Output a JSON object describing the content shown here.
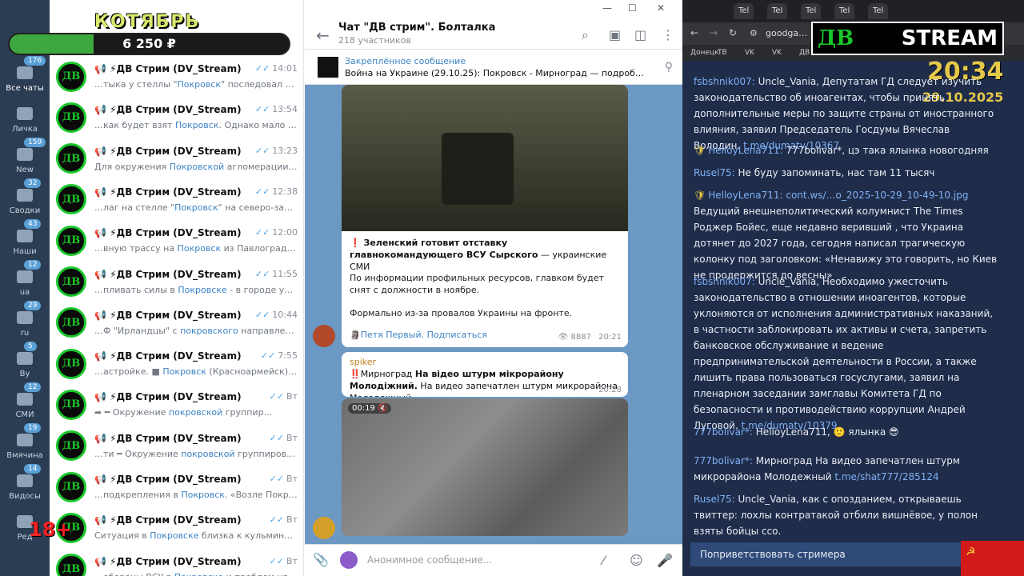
{
  "rail": {
    "items": [
      {
        "label": "Все чаты",
        "badge": "176"
      },
      {
        "label": "Личка",
        "badge": ""
      },
      {
        "label": "New",
        "badge": "159"
      },
      {
        "label": "Сводки",
        "badge": "32"
      },
      {
        "label": "Наши",
        "badge": "43"
      },
      {
        "label": "ua",
        "badge": "12"
      },
      {
        "label": "ru",
        "badge": "29"
      },
      {
        "label": "By",
        "badge": "5"
      },
      {
        "label": "СМИ",
        "badge": "12"
      },
      {
        "label": "Вмячина",
        "badge": "19"
      },
      {
        "label": "Видосы",
        "badge": "14"
      },
      {
        "label": "Ред",
        "badge": ""
      }
    ]
  },
  "overlay": {
    "month": "КОТЯБРЬ",
    "donation": "6 250 ₽",
    "donation_progress": 0.3,
    "age": "18+"
  },
  "chatlist": {
    "avatar_text": "ДВ",
    "chats": [
      {
        "name": "📢 ⚡ДВ Стрим (DV_Stream)",
        "time": "14:01",
        "pre": "…тыка у стеллы \"",
        "hl": "Покровск",
        "post": "\" последовал флаг…"
      },
      {
        "name": "📢 ⚡ДВ Стрим (DV_Stream)",
        "time": "13:54",
        "pre": "…как будет взят ",
        "hl": "Покровск",
        "post": ". Однако мало тог…"
      },
      {
        "name": "📢 ⚡ДВ Стрим (DV_Stream)",
        "time": "13:23",
        "pre": "Для окружения ",
        "hl": "Покровской",
        "post": " агломерации прот…"
      },
      {
        "name": "📢 ⚡ДВ Стрим (DV_Stream)",
        "time": "12:38",
        "pre": "…лаг на стелле \"",
        "hl": "Покровск",
        "post": "\" на северо-запад…"
      },
      {
        "name": "📢 ⚡ДВ Стрим (DV_Stream)",
        "time": "12:00",
        "pre": "…вную трассу на ",
        "hl": "Покровск",
        "post": " из Павлограда. …"
      },
      {
        "name": "📢 ⚡ДВ Стрим (DV_Stream)",
        "time": "11:55",
        "pre": "…пливать силы в ",
        "hl": "Покровске",
        "post": " - в городе уже \"…"
      },
      {
        "name": "📢 ⚡ДВ Стрим (DV_Stream)",
        "time": "10:44",
        "pre": "…Ф \"Ирландцы\" с ",
        "hl": "покровского",
        "post": " направлени…"
      },
      {
        "name": "📢 ⚡ДВ Стрим (DV_Stream)",
        "time": "7:55",
        "pre": "…астройке. ■ ",
        "hl": "Покровск",
        "post": " (Красноармейск) …"
      },
      {
        "name": "📢 ⚡ДВ Стрим (DV_Stream)",
        "time": "Вт",
        "pre": "➦ ━ Окружение ",
        "hl": "покровской",
        "post": " группир…"
      },
      {
        "name": "📢 ⚡ДВ Стрим (DV_Stream)",
        "time": "Вт",
        "pre": "…ти ━ Окружение ",
        "hl": "покровской",
        "post": " группиров…"
      },
      {
        "name": "📢 ⚡ДВ Стрим (DV_Stream)",
        "time": "Вт",
        "pre": "…подкрепления в ",
        "hl": "Покровск",
        "post": ". «Возле Покровска…"
      },
      {
        "name": "📢 ⚡ДВ Стрим (DV_Stream)",
        "time": "Вт",
        "pre": "Ситуация в ",
        "hl": "Покровске",
        "post": " близка к кульминаци…"
      },
      {
        "name": "📢 ⚡ДВ Стрим (DV_Stream)",
        "time": "Вт",
        "pre": "…обороны ВСУ в ",
        "hl": "Покровске",
        "post": " и проблем на…"
      }
    ]
  },
  "main": {
    "title": "Чат \"ДВ стрим\". Болталка",
    "subtitle": "218 участников",
    "pinned_title": "Закреплённое сообщение",
    "pinned_text": "Война на Украине (29.10.25): Покровск - Мирноград — подробный ра…",
    "post": {
      "title_bold": "❗ Зеленский готовит отставку главнокомандующего ВСУ Сырского",
      "title_rest": " — украинские СМИ",
      "p1": "По информации профильных ресурсов, главком будет снят с должности в ноябре.",
      "p2": "Формально из-за провалов Украины на фронте.",
      "sender": "🗿Петя Первый. Подписаться",
      "views": "8887",
      "time": "20:21"
    },
    "spiker": {
      "name": "spiker",
      "pre": "‼️Мирноград ",
      "bold": "На відео штурм мікрорайону Молодіжний.",
      "post": "  На видео запечатлен штурм микрорайона Молодежный",
      "time": "20:28"
    },
    "video_time": "00:19",
    "input_placeholder": "Анонимное сообщение..."
  },
  "browser": {
    "tabs": [
      "Tel",
      "Tel",
      "Tel",
      "Tel",
      "Tel"
    ],
    "address": "goodga…",
    "bookmarks": [
      "Донецк",
      "ТВ",
      "VK",
      "VK",
      "ДВ"
    ],
    "logo_a": "ДВ",
    "logo_b": "STREAM",
    "clock": "20:34",
    "date": "29.10.2025",
    "greet": "Поприветствовать стримера",
    "messages": [
      {
        "user": "fsbshnik007:",
        "badge": false,
        "text": " Uncle_Vania, Депутатам ГД следует изучить законодательство об иноагентах, чтобы принять дополнительные меры по защите страны от иностранного влияния, заявил Председатель Госдумы Вячеслав Володин. ",
        "link": "t.me/dumatv/10367"
      },
      {
        "user": "HelloyLena711:",
        "badge": true,
        "text": " 777bolivar*, цэ така ялынка новогодняя",
        "link": ""
      },
      {
        "user": "Rusel75:",
        "badge": false,
        "text": " Не буду запоминать, нас там 11 тысяч",
        "link": ""
      },
      {
        "user": "HelloyLena711:",
        "badge": true,
        "text": " ",
        "link": "cont.ws/…o_2025-10-29_10-49-10.jpg",
        "after": " Ведущий внешнеполитический колумнист The Times Роджер Бойес, еще недавно веривший , что Украина дотянет до 2027 года, сегодня написал трагическую колонку под заголовком: «Ненавижу это говорить, но Киев не продержится до весны»"
      },
      {
        "user": "fsbshnik007:",
        "badge": false,
        "text": " Uncle_Vania, Необходимо ужесточить законодательство в отношении иноагентов, которые уклоняются от исполнения административных наказаний, в частности заблокировать их активы и счета, запретить банковское обслуживание и ведение предпринимательской деятельности в России, а также лишить права пользоваться госуслугами, заявил на пленарном заседании замглавы Комитета ГД по безопасности и противодействию коррупции Андрей Луговой. ",
        "link": "t.me/dumatv/10379"
      },
      {
        "user": "777bolivar*:",
        "badge": false,
        "text": " HelloyLena711, 🙂 ялынка 😎",
        "link": ""
      },
      {
        "user": "777bolivar*:",
        "badge": false,
        "text": " Мирноград На видео запечатлен штурм микрорайона Молодежный ",
        "link": "t.me/shat777/285124"
      },
      {
        "user": "Rusel75:",
        "badge": false,
        "text": " Uncle_Vania, как с опозданием, открываешь твиттер: лохлы контратакой отбили вишнёвое, у полон взяты бойцы ссо.",
        "link": ""
      }
    ]
  }
}
